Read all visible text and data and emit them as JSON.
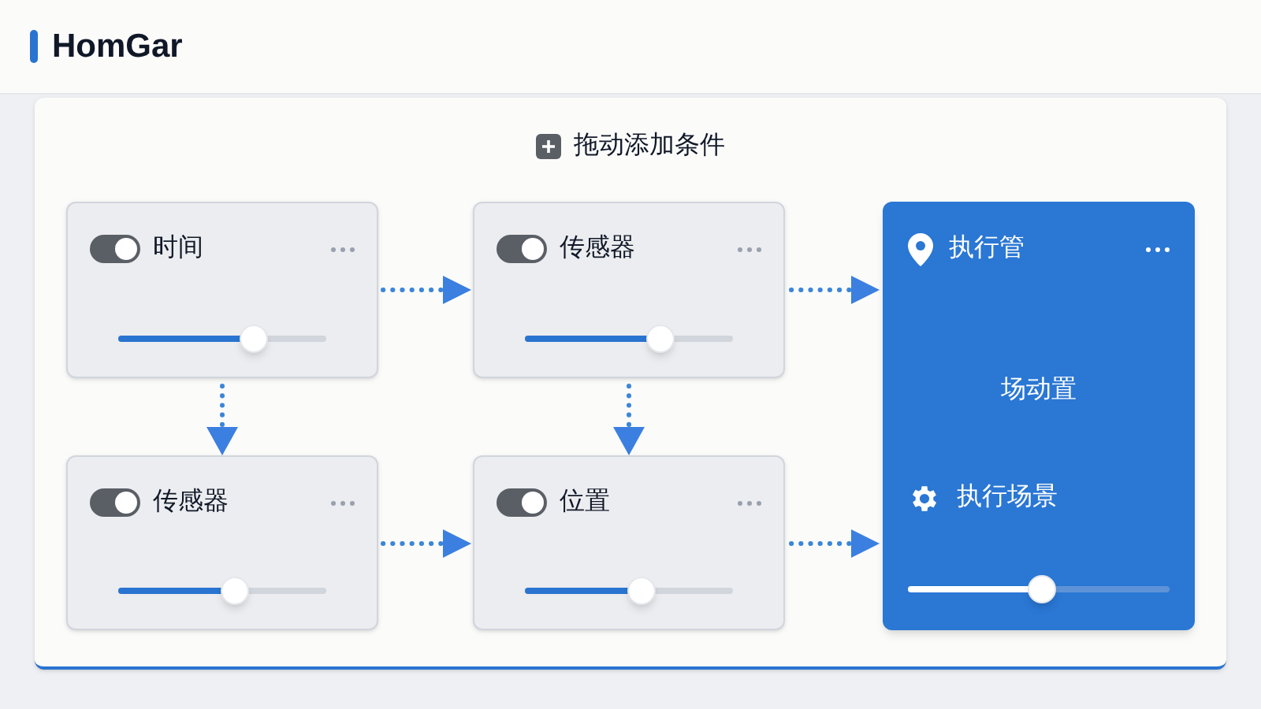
{
  "header": {
    "title": "HomGar"
  },
  "add_condition": {
    "label": "拖动添加条件"
  },
  "conditions": [
    {
      "label": "时间",
      "on": true,
      "level": 0.65
    },
    {
      "label": "传感器",
      "on": true,
      "level": 0.65
    },
    {
      "label": "传感器",
      "on": true,
      "level": 0.56
    },
    {
      "label": "位置",
      "on": true,
      "level": 0.56
    }
  ],
  "action_card": {
    "title": "执行管",
    "center_text": "场动置",
    "scene_label": "执行场景",
    "level": 0.51
  }
}
